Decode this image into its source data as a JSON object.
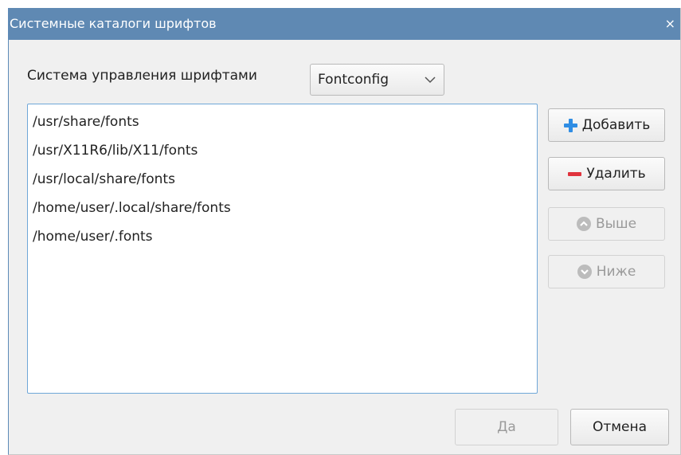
{
  "dialog": {
    "title": "Системные каталоги шрифтов",
    "close_glyph": "×"
  },
  "font_management": {
    "label": "Система управления шрифтами",
    "selected": "Fontconfig"
  },
  "directories": [
    "/usr/share/fonts",
    "/usr/X11R6/lib/X11/fonts",
    "/usr/local/share/fonts",
    "/home/user/.local/share/fonts",
    "/home/user/.fonts"
  ],
  "side_buttons": {
    "add": "Добавить",
    "remove": "Удалить",
    "up": "Выше",
    "down": "Ниже"
  },
  "footer": {
    "ok": "Да",
    "cancel": "Отмена"
  },
  "icons": {
    "add": "plus-icon",
    "remove": "minus-icon",
    "up": "chevron-up-circle-icon",
    "down": "chevron-down-circle-icon",
    "select": "chevron-down-icon",
    "close": "close-icon"
  },
  "colors": {
    "titlebar": "#5f89b3",
    "add_icon": "#2f8de4",
    "remove_icon": "#e0333d",
    "list_border": "#6fa7d8"
  }
}
